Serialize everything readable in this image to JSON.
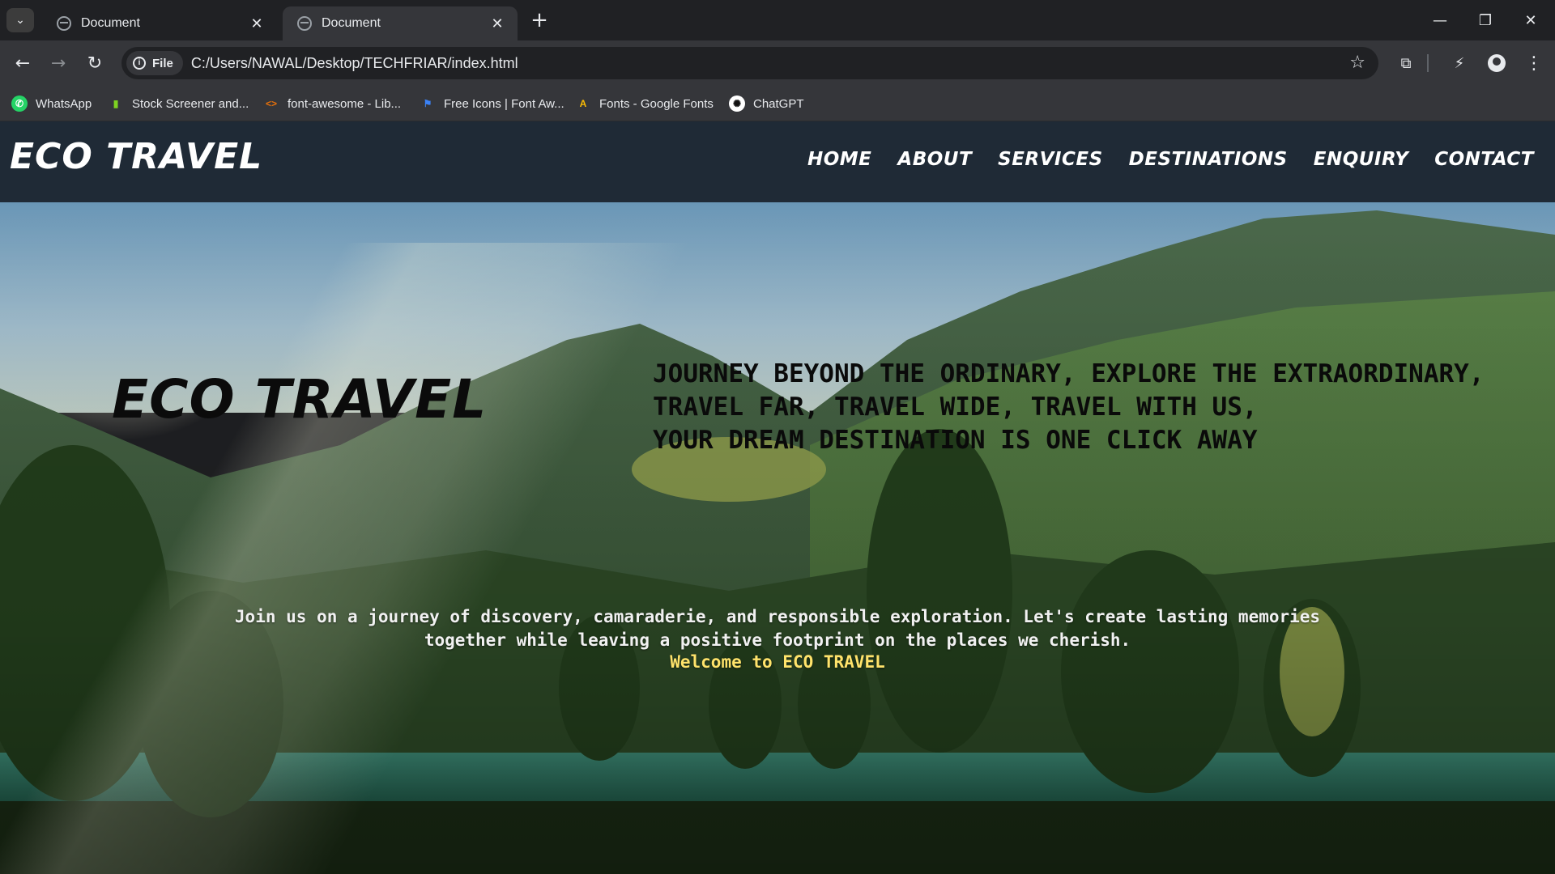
{
  "browser": {
    "tabs": [
      {
        "title": "Document",
        "active": false
      },
      {
        "title": "Document",
        "active": true
      }
    ],
    "address_chip": "File",
    "url": "C:/Users/NAWAL/Desktop/TECHFRIAR/index.html",
    "bookmarks": [
      {
        "label": "WhatsApp",
        "icon": "whatsapp-icon"
      },
      {
        "label": "Stock Screener and...",
        "icon": "bar-chart-icon"
      },
      {
        "label": "font-awesome - Lib...",
        "icon": "code-icon"
      },
      {
        "label": "Free Icons | Font Aw...",
        "icon": "flag-icon"
      },
      {
        "label": "Fonts - Google Fonts",
        "icon": "google-fonts-icon"
      },
      {
        "label": "ChatGPT",
        "icon": "chatgpt-icon"
      }
    ]
  },
  "site": {
    "logo": "ECO TRAVEL",
    "nav": [
      "HOME",
      "ABOUT",
      "SERVICES",
      "DESTINATIONS",
      "ENQUIRY",
      "CONTACT"
    ],
    "hero_title": "ECO TRAVEL",
    "tagline": [
      "JOURNEY BEYOND THE ORDINARY, EXPLORE THE EXTRAORDINARY,",
      "TRAVEL FAR, TRAVEL WIDE, TRAVEL WITH US,",
      "YOUR DREAM DESTINATION IS ONE CLICK AWAY"
    ],
    "intro": "Join us on a journey of discovery, camaraderie, and responsible exploration. Let's create lasting memories together while leaving a positive footprint on the places we cherish.",
    "welcome": "Welcome to ECO TRAVEL"
  },
  "colors": {
    "navbar": "#1f2a36",
    "welcome_text": "#ffe36b",
    "chrome_dark": "#202124",
    "chrome_toolbar": "#35363a"
  }
}
